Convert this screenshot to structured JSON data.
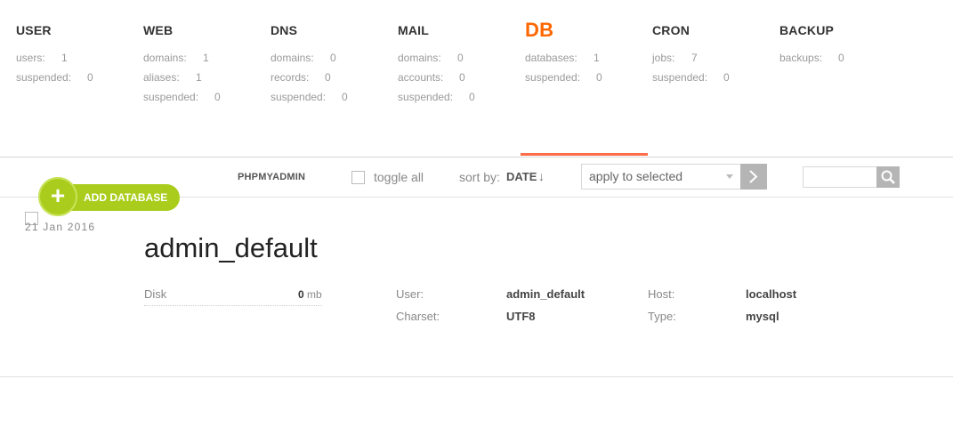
{
  "stats": {
    "user": {
      "title": "USER",
      "rows": [
        {
          "label": "users:",
          "value": "1"
        },
        {
          "label": "suspended:",
          "value": "0"
        }
      ]
    },
    "web": {
      "title": "WEB",
      "rows": [
        {
          "label": "domains:",
          "value": "1"
        },
        {
          "label": "aliases:",
          "value": "1"
        },
        {
          "label": "suspended:",
          "value": "0"
        }
      ]
    },
    "dns": {
      "title": "DNS",
      "rows": [
        {
          "label": "domains:",
          "value": "0"
        },
        {
          "label": "records:",
          "value": "0"
        },
        {
          "label": "suspended:",
          "value": "0"
        }
      ]
    },
    "mail": {
      "title": "MAIL",
      "rows": [
        {
          "label": "domains:",
          "value": "0"
        },
        {
          "label": "accounts:",
          "value": "0"
        },
        {
          "label": "suspended:",
          "value": "0"
        }
      ]
    },
    "db": {
      "title": "DB",
      "rows": [
        {
          "label": "databases:",
          "value": "1"
        },
        {
          "label": "suspended:",
          "value": "0"
        }
      ]
    },
    "cron": {
      "title": "CRON",
      "rows": [
        {
          "label": "jobs:",
          "value": "7"
        },
        {
          "label": "suspended:",
          "value": "0"
        }
      ]
    },
    "backup": {
      "title": "BACKUP",
      "rows": [
        {
          "label": "backups:",
          "value": "0"
        }
      ]
    }
  },
  "toolbar": {
    "add_label": "ADD DATABASE",
    "add_icon": "plus-icon",
    "phpmyadmin": "PHPMYADMIN",
    "toggle_all": "toggle all",
    "sort_label": "sort by:",
    "sort_value": "DATE",
    "sort_arrow": "↓",
    "apply_selected": "apply to selected",
    "go_icon": "chevron-right-icon",
    "search_icon": "search-icon"
  },
  "record": {
    "date": "21 Jan 2016",
    "name": "admin_default",
    "disk_label": "Disk",
    "disk_value": "0",
    "disk_unit": "mb",
    "user_label": "User:",
    "user_value": "admin_default",
    "charset_label": "Charset:",
    "charset_value": "UTF8",
    "host_label": "Host:",
    "host_value": "localhost",
    "type_label": "Type:",
    "type_value": "mysql"
  },
  "colors": {
    "accent": "#ff6701",
    "add_green": "#aacd1d",
    "underline": "#ff6e4a"
  }
}
